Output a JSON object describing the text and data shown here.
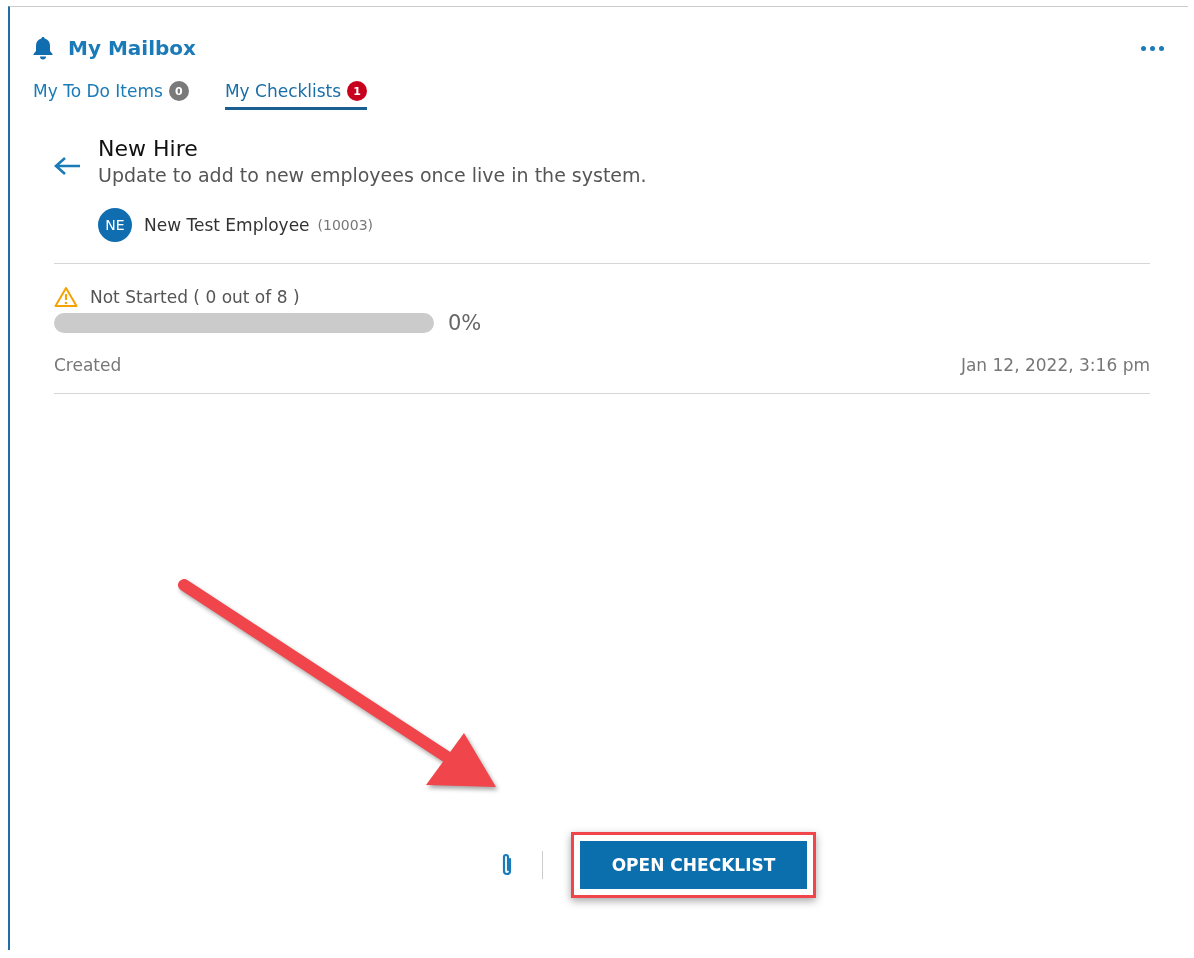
{
  "header": {
    "title": "My Mailbox"
  },
  "tabs": [
    {
      "label": "My To Do Items",
      "badge": "0",
      "color": "#7a7a7a",
      "selected": false
    },
    {
      "label": "My Checklists",
      "badge": "1",
      "color": "#c8001e",
      "selected": true
    }
  ],
  "checklist": {
    "title": "New Hire",
    "description": "Update to add to new employees once live in the system.",
    "employee": {
      "initials": "NE",
      "name": "New Test Employee",
      "id": "(10003)"
    },
    "status": "Not Started ( 0 out of 8 )",
    "level": 0,
    "percent": "0%",
    "created_label": "Created",
    "created_value": "Jan 12, 2022, 3:16 pm"
  },
  "footer": {
    "button": "OPEN CHECKLIST",
    "highlighted": true
  }
}
